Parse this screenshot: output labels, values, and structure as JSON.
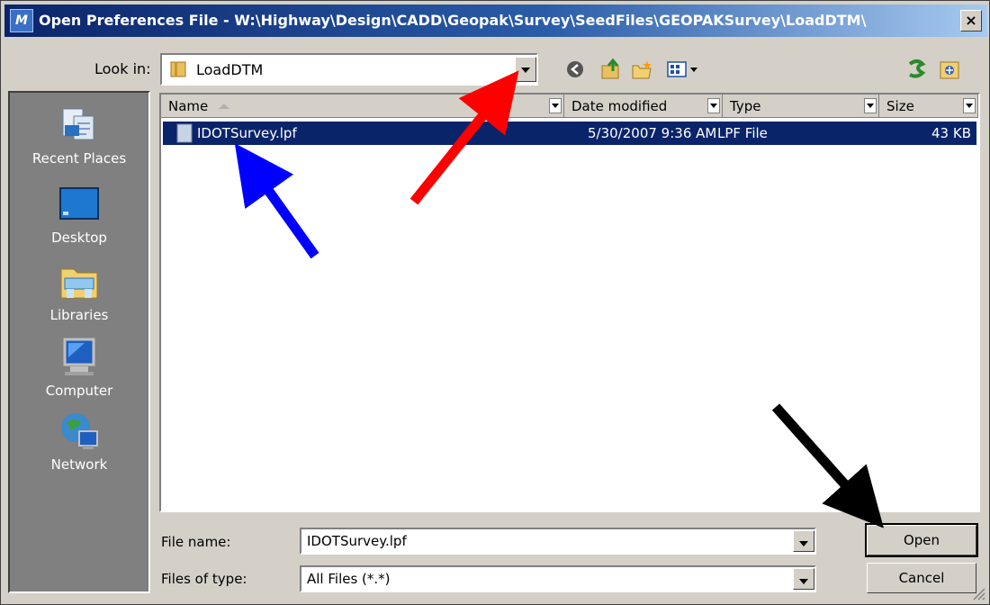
{
  "window": {
    "title": "Open Preferences File - W:\\Highway\\Design\\CADD\\Geopak\\Survey\\SeedFiles\\GEOPAKSurvey\\LoadDTM\\",
    "close_label": "×"
  },
  "look_in": {
    "label": "Look in:",
    "value": "LoadDTM"
  },
  "places": [
    {
      "label": "Recent Places"
    },
    {
      "label": "Desktop"
    },
    {
      "label": "Libraries"
    },
    {
      "label": "Computer"
    },
    {
      "label": "Network"
    }
  ],
  "columns": {
    "name": "Name",
    "date": "Date modified",
    "type": "Type",
    "size": "Size"
  },
  "files": [
    {
      "name": "IDOTSurvey.lpf",
      "date": "5/30/2007 9:36 AM",
      "type": "LPF File",
      "size": "43 KB"
    }
  ],
  "file_name": {
    "label": "File name:",
    "value": "IDOTSurvey.lpf"
  },
  "file_type": {
    "label": "Files of type:",
    "value": "All Files (*.*)"
  },
  "buttons": {
    "open": "Open",
    "cancel": "Cancel"
  },
  "colors": {
    "selection": "#0a246a",
    "arrow_red": "#ff0000",
    "arrow_blue": "#0000ff",
    "arrow_black": "#000000"
  }
}
